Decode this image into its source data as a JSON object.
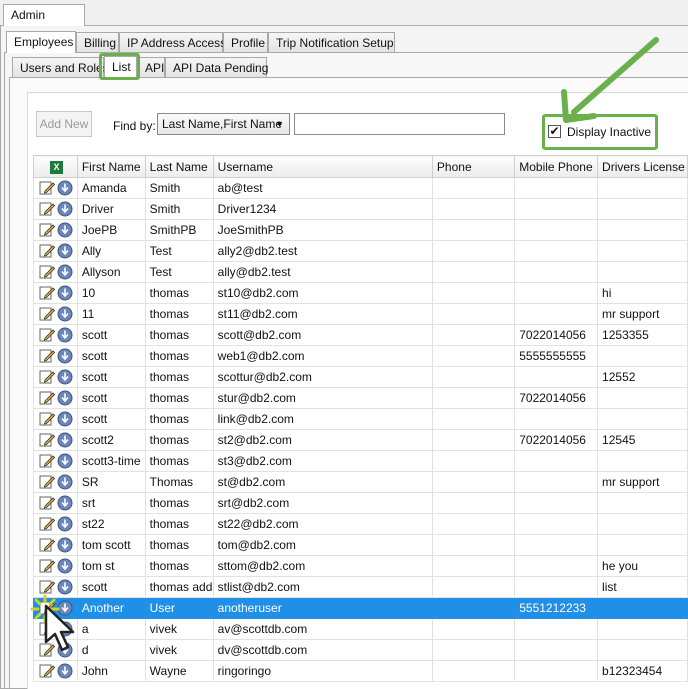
{
  "window": {
    "tab": "Admin"
  },
  "tabs_main": [
    "Employees",
    "Billing",
    "IP Address Access",
    "Profile",
    "Trip Notification Setup"
  ],
  "tabs_sub": [
    "Users and Roles",
    "List",
    "API",
    "API Data Pending"
  ],
  "toolbar": {
    "add_new": "Add New",
    "find_by_label": "Find by:",
    "find_by_value": "Last Name,First Name",
    "search_value": "",
    "display_inactive_label": "Display Inactive",
    "display_inactive_checked": true
  },
  "grid": {
    "columns": [
      "First Name",
      "Last Name",
      "Username",
      "Phone",
      "Mobile Phone",
      "Drivers License"
    ],
    "rows": [
      [
        "Amanda",
        "Smith",
        "ab@test",
        "",
        "",
        ""
      ],
      [
        "Driver",
        "Smith",
        "Driver1234",
        "",
        "",
        ""
      ],
      [
        "JoePB",
        "SmithPB",
        "JoeSmithPB",
        "",
        "",
        ""
      ],
      [
        "Ally",
        "Test",
        "ally2@db2.test",
        "",
        "",
        ""
      ],
      [
        "Allyson",
        "Test",
        "ally@db2.test",
        "",
        "",
        ""
      ],
      [
        "10",
        "thomas",
        "st10@db2.com",
        "",
        "",
        "hi"
      ],
      [
        "11",
        "thomas",
        "st11@db2.com",
        "",
        "",
        "mr support"
      ],
      [
        "scott",
        "thomas",
        "scott@db2.com",
        "",
        "7022014056",
        "1253355"
      ],
      [
        "scott",
        "thomas",
        "web1@db2.com",
        "",
        "5555555555",
        ""
      ],
      [
        "scott",
        "thomas",
        "scottur@db2.com",
        "",
        "",
        "12552"
      ],
      [
        "scott",
        "thomas",
        "stur@db2.com",
        "",
        "7022014056",
        ""
      ],
      [
        "scott",
        "thomas",
        "link@db2.com",
        "",
        "",
        ""
      ],
      [
        "scott2",
        "thomas",
        "st2@db2.com",
        "",
        "7022014056",
        "12545"
      ],
      [
        "scott3-time",
        "thomas",
        "st3@db2.com",
        "",
        "",
        ""
      ],
      [
        "SR",
        "Thomas",
        "st@db2.com",
        "",
        "",
        "mr support"
      ],
      [
        "srt",
        "thomas",
        "srt@db2.com",
        "",
        "",
        ""
      ],
      [
        "st22",
        "thomas",
        "st22@db2.com",
        "",
        "",
        ""
      ],
      [
        "tom scott",
        "thomas",
        "tom@db2.com",
        "",
        "",
        ""
      ],
      [
        "tom st",
        "thomas",
        "sttom@db2.com",
        "",
        "",
        "he you"
      ],
      [
        "scott",
        "thomas add",
        "stlist@db2.com",
        "",
        "",
        "list"
      ],
      [
        "Another",
        "User",
        "anotheruser",
        "",
        "5551212233",
        ""
      ],
      [
        "a",
        "vivek",
        "av@scottdb.com",
        "",
        "",
        ""
      ],
      [
        "d",
        "vivek",
        "dv@scottdb.com",
        "",
        "",
        ""
      ],
      [
        "John",
        "Wayne",
        "ringoringo",
        "",
        "",
        "b12323454"
      ]
    ],
    "selected_row": 20
  },
  "colors": {
    "highlight": "#6ab04c",
    "selection": "#1f8fe8"
  }
}
